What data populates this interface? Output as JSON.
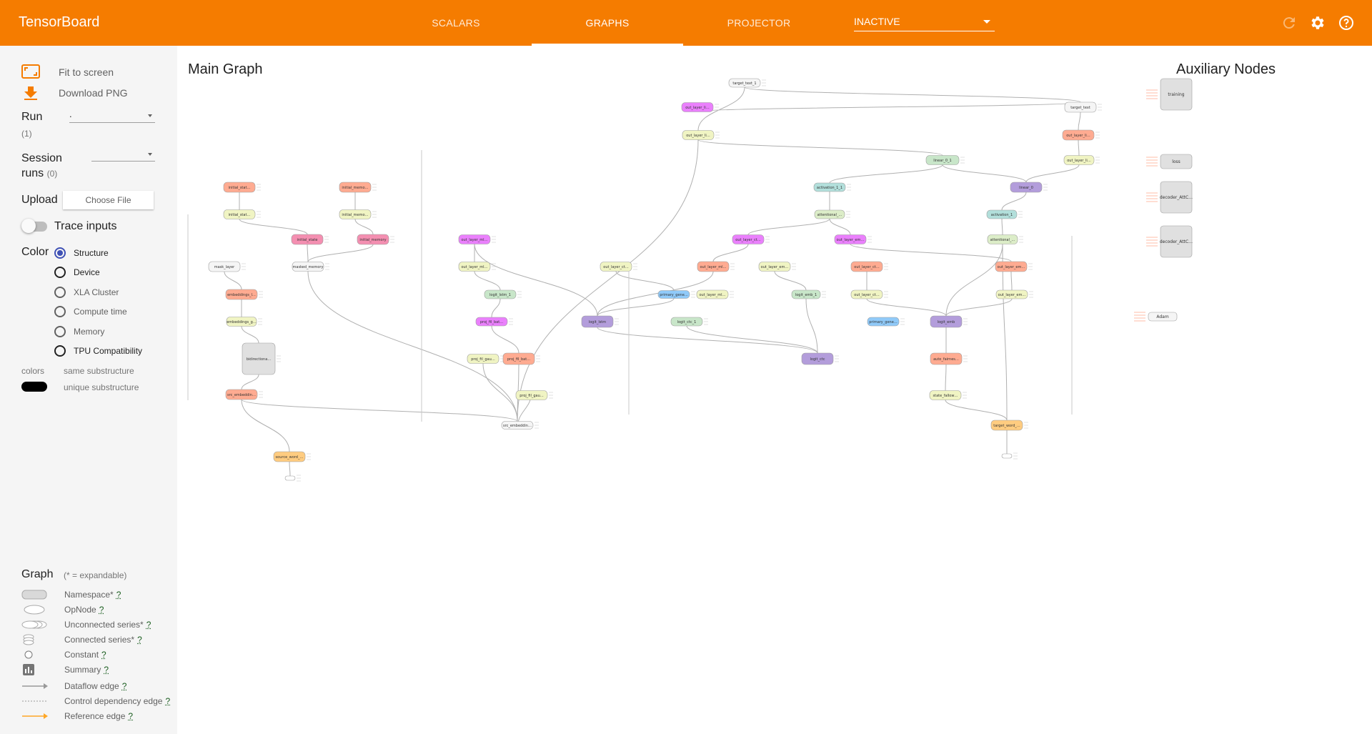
{
  "app": {
    "title": "TensorBoard"
  },
  "tabs": [
    {
      "label": "SCALARS"
    },
    {
      "label": "GRAPHS"
    },
    {
      "label": "PROJECTOR"
    }
  ],
  "plugin_select": {
    "value": "INACTIVE"
  },
  "icons": {
    "reload": "reload-icon",
    "settings": "gear-icon",
    "help": "help-icon"
  },
  "colors": {
    "brand": "#f57c00",
    "accent": "#3f51b5"
  },
  "sidebar": {
    "fit_to_screen": "Fit to screen",
    "download_png": "Download PNG",
    "run_label": "Run",
    "run_count": "(1)",
    "run_value": ".",
    "session_runs_label_1": "Session",
    "session_runs_label_2": "runs",
    "session_runs_count": "(0)",
    "upload_label": "Upload",
    "choose_file": "Choose File",
    "trace_inputs": "Trace inputs",
    "color_label": "Color",
    "color_options": [
      "Structure",
      "Device",
      "XLA Cluster",
      "Compute time",
      "Memory",
      "TPU Compatibility"
    ],
    "colors_label": "colors",
    "same_substructure": "same substructure",
    "unique_substructure": "unique substructure"
  },
  "legend": {
    "title": "Graph",
    "expandable_note": "(* = expandable)",
    "items": [
      "Namespace*",
      "OpNode",
      "Unconnected series*",
      "Connected series*",
      "Constant",
      "Summary",
      "Dataflow edge",
      "Control dependency edge",
      "Reference edge"
    ],
    "help": "?"
  },
  "graph": {
    "main_title": "Main Graph",
    "aux_title": "Auxiliary Nodes",
    "nodes": [
      {
        "label": "target_text_1",
        "color": "#f5f5f5"
      },
      {
        "label": "target_text",
        "color": "#f5f5f5"
      },
      {
        "label": "out_layer_linear",
        "color": "#ea80fc"
      },
      {
        "label": "out_layer_linear_g",
        "color": "#f0f4c3"
      },
      {
        "label": "out_layer_linear_1",
        "color": "#ffab91"
      },
      {
        "label": "out_layer_linear_g1",
        "color": "#f0f4c3"
      },
      {
        "label": "linear_0_1",
        "color": "#c8e6c9"
      },
      {
        "label": "activation_1_1",
        "color": "#b2dfdb"
      },
      {
        "label": "linear_0",
        "color": "#b39ddb"
      },
      {
        "label": "attentional_input_1",
        "color": "#dcedc8"
      },
      {
        "label": "activation_1",
        "color": "#b2dfdb"
      },
      {
        "label": "attentional_input",
        "color": "#dcedc8"
      },
      {
        "label": "initial_state_lstm",
        "color": "#ffab91"
      },
      {
        "label": "initial_state_gather",
        "color": "#f0f4c3"
      },
      {
        "label": "initial_memory_lstm",
        "color": "#ffab91"
      },
      {
        "label": "initial_memory_g",
        "color": "#f0f4c3"
      },
      {
        "label": "initial_state",
        "color": "#f48fb1"
      },
      {
        "label": "initial_memory",
        "color": "#f48fb1"
      },
      {
        "label": "mask_layer",
        "color": "#f5f5f5"
      },
      {
        "label": "masked_memory",
        "color": "#f5f5f5"
      },
      {
        "label": "embeddings_lstm",
        "color": "#ffab91"
      },
      {
        "label": "embeddings_gather",
        "color": "#f0f4c3"
      },
      {
        "label": "bidirectional_encoder",
        "color": "#e0e0e0"
      },
      {
        "label": "src_embedding_lstm",
        "color": "#ffab91"
      },
      {
        "label": "source_word_embedding",
        "color": "#ffcc80"
      },
      {
        "label": "source_1",
        "color": "#ffffff"
      },
      {
        "label": "out_layer_mlp_lstm",
        "color": "#ea80fc"
      },
      {
        "label": "out_layer_ctc_lstm",
        "color": "#ea80fc"
      },
      {
        "label": "out_layer_emb_lstm",
        "color": "#ea80fc"
      },
      {
        "label": "out_layer_mlp_g",
        "color": "#f0f4c3"
      },
      {
        "label": "out_layer_ctc_g",
        "color": "#f0f4c3"
      },
      {
        "label": "out_layer_mlp_lstm2",
        "color": "#ffab91"
      },
      {
        "label": "out_layer_emb_g",
        "color": "#f0f4c3"
      },
      {
        "label": "out_layer_ctc_lstm2",
        "color": "#ffab91"
      },
      {
        "label": "out_layer_emb_lstm2",
        "color": "#ffab91"
      },
      {
        "label": "logit_lstm_1",
        "color": "#c8e6c9"
      },
      {
        "label": "primary_general",
        "color": "#90caf9"
      },
      {
        "label": "out_layer_mlp_g2",
        "color": "#f0f4c3"
      },
      {
        "label": "logit_emb_1",
        "color": "#c8e6c9"
      },
      {
        "label": "out_layer_ctc_g2",
        "color": "#f0f4c3"
      },
      {
        "label": "out_layer_emb_g2",
        "color": "#f0f4c3"
      },
      {
        "label": "proj_fil_batch_norm",
        "color": "#ea80fc"
      },
      {
        "label": "logit_lstm",
        "color": "#b39ddb"
      },
      {
        "label": "logit_ctc_1",
        "color": "#c8e6c9"
      },
      {
        "label": "primary_general2",
        "color": "#90caf9"
      },
      {
        "label": "logit_emb",
        "color": "#b39ddb"
      },
      {
        "label": "proj_fil_gaussian",
        "color": "#f0f4c3"
      },
      {
        "label": "proj_fil_batch_norm2",
        "color": "#ffab91"
      },
      {
        "label": "logit_ctc",
        "color": "#b39ddb"
      },
      {
        "label": "auto_fairness_lstm",
        "color": "#ffab91"
      },
      {
        "label": "proj_fil_gaussian2",
        "color": "#f0f4c3"
      },
      {
        "label": "state_fallow_gauss",
        "color": "#f0f4c3"
      },
      {
        "label": "src_embedding_g",
        "color": "#f5f5f5"
      },
      {
        "label": "target_word_emb",
        "color": "#ffcc80"
      },
      {
        "label": "keep_fall",
        "color": "#ffffff"
      }
    ],
    "aux_nodes": [
      {
        "label": "training",
        "color": "#e0e0e0"
      },
      {
        "label": "loss",
        "color": "#e0e0e0"
      },
      {
        "label": "decoder_AttCon",
        "color": "#e0e0e0"
      },
      {
        "label": "decoder_AttCon",
        "color": "#e0e0e0"
      },
      {
        "label": "Adam",
        "color": "#f5f5f5"
      }
    ]
  }
}
